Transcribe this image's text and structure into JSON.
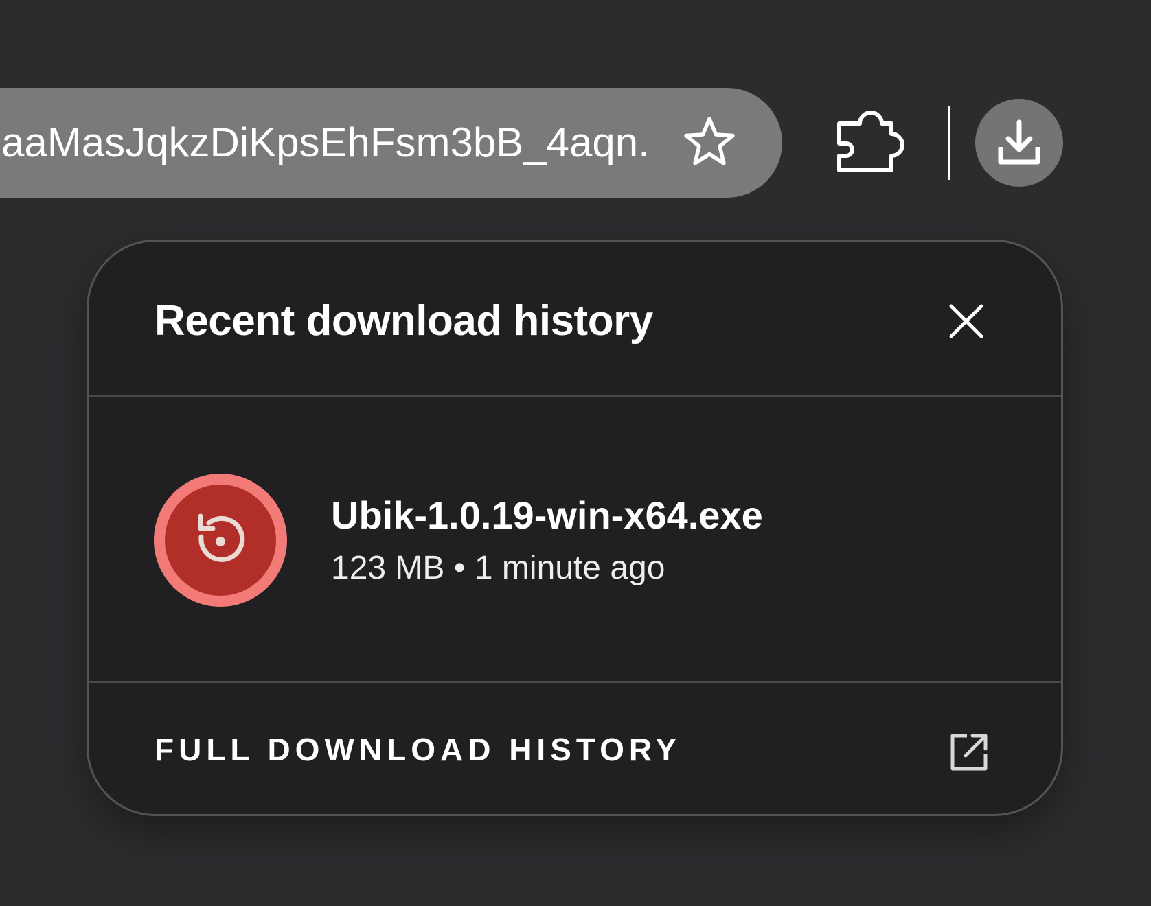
{
  "toolbar": {
    "address_text": "aaMasJqkzDiKpsEhFsm3bB_4aqn...",
    "bookmark_icon": "star-outline-icon",
    "extensions_icon": "puzzle-piece-icon",
    "downloads_icon": "download-icon"
  },
  "download_panel": {
    "title": "Recent download history",
    "close_icon": "close-icon",
    "items": [
      {
        "file_name": "Ubik-1.0.19-win-x64.exe",
        "meta": "123 MB • 1 minute ago",
        "status_icon": "retry-icon",
        "status_color": "#b22f29",
        "status_ring_color": "#f27b77"
      }
    ],
    "full_history_label": "FULL DOWNLOAD HISTORY",
    "full_history_icon": "open-in-new-icon"
  },
  "colors": {
    "background": "#2c2c2f",
    "address_bar": "#7a7a7b",
    "panel": "#202022",
    "panel_border": "#545456"
  }
}
